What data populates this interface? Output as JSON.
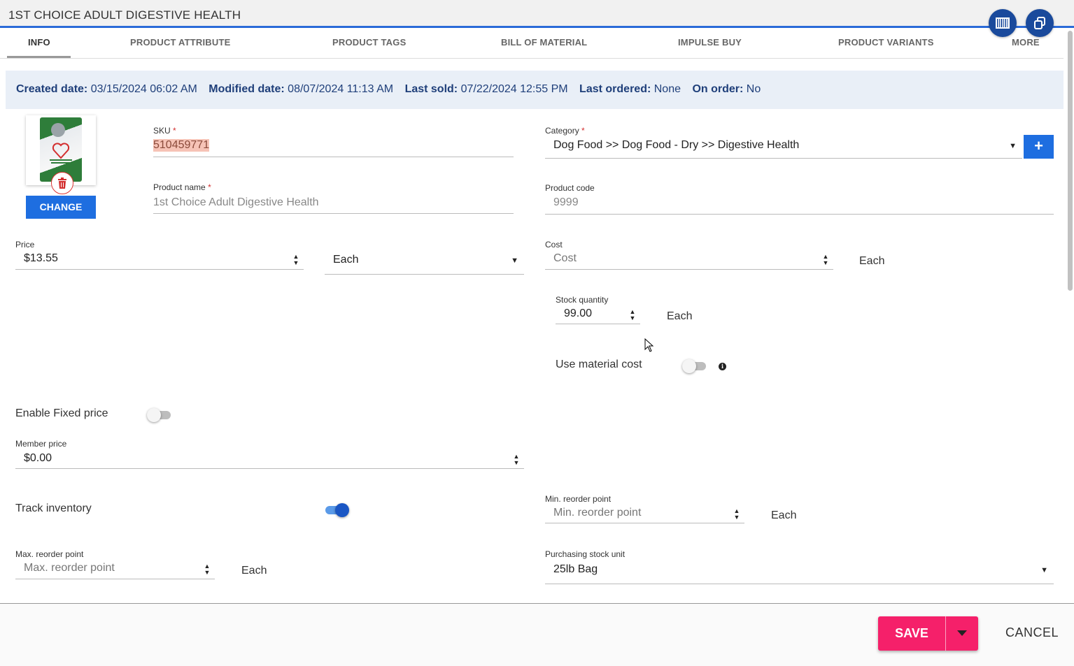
{
  "window": {
    "title": "1ST CHOICE ADULT DIGESTIVE HEALTH"
  },
  "header_actions": [
    {
      "icon": "barcode-icon"
    },
    {
      "icon": "copy-icon"
    }
  ],
  "tabs": [
    {
      "label": "INFO",
      "active": true
    },
    {
      "label": "PRODUCT ATTRIBUTE"
    },
    {
      "label": "PRODUCT TAGS"
    },
    {
      "label": "BILL OF MATERIAL"
    },
    {
      "label": "IMPULSE BUY"
    },
    {
      "label": "PRODUCT VARIANTS"
    },
    {
      "label": "MORE"
    }
  ],
  "info": {
    "created_label": "Created date:",
    "created_value": "03/15/2024 06:02 AM",
    "modified_label": "Modified date:",
    "modified_value": "08/07/2024 11:13 AM",
    "last_sold_label": "Last sold:",
    "last_sold_value": "07/22/2024 12:55 PM",
    "last_ordered_label": "Last ordered:",
    "last_ordered_value": "None",
    "on_order_label": "On order:",
    "on_order_value": "No"
  },
  "image": {
    "change_label": "CHANGE"
  },
  "form": {
    "sku": {
      "label": "SKU",
      "required": "*",
      "value": "510459771"
    },
    "product_name": {
      "label": "Product name",
      "required": "*",
      "value": "1st Choice Adult Digestive Health"
    },
    "category": {
      "label": "Category",
      "required": "*",
      "value": "Dog Food >> Dog Food - Dry >> Digestive Health",
      "add_label": "+"
    },
    "product_code": {
      "label": "Product code",
      "value": "9999"
    },
    "price": {
      "label": "Price",
      "value": "$13.55"
    },
    "price_unit": {
      "value": "Each"
    },
    "cost": {
      "label": "Cost",
      "placeholder": "Cost",
      "unit": "Each"
    },
    "stock_quantity": {
      "label": "Stock quantity",
      "value": "99.00",
      "unit": "Each"
    },
    "use_material_cost": {
      "label": "Use material cost",
      "on": false
    },
    "fixed_price": {
      "label": "Enable Fixed price",
      "on": false
    },
    "member_price": {
      "label": "Member price",
      "value": "$0.00"
    },
    "track_inventory": {
      "label": "Track inventory",
      "on": true
    },
    "min_reorder": {
      "label": "Min. reorder point",
      "placeholder": "Min. reorder point",
      "unit": "Each"
    },
    "max_reorder": {
      "label": "Max. reorder point",
      "placeholder": "Max. reorder point",
      "unit": "Each"
    },
    "purchasing_unit": {
      "label": "Purchasing stock unit",
      "value": "25lb Bag"
    }
  },
  "footer": {
    "save_label": "SAVE",
    "cancel_label": "CANCEL"
  },
  "colors": {
    "accent": "#1e6ee0",
    "save": "#f5206a",
    "info_bg": "#e9eff7",
    "title_underline": "#2a6ad8"
  }
}
